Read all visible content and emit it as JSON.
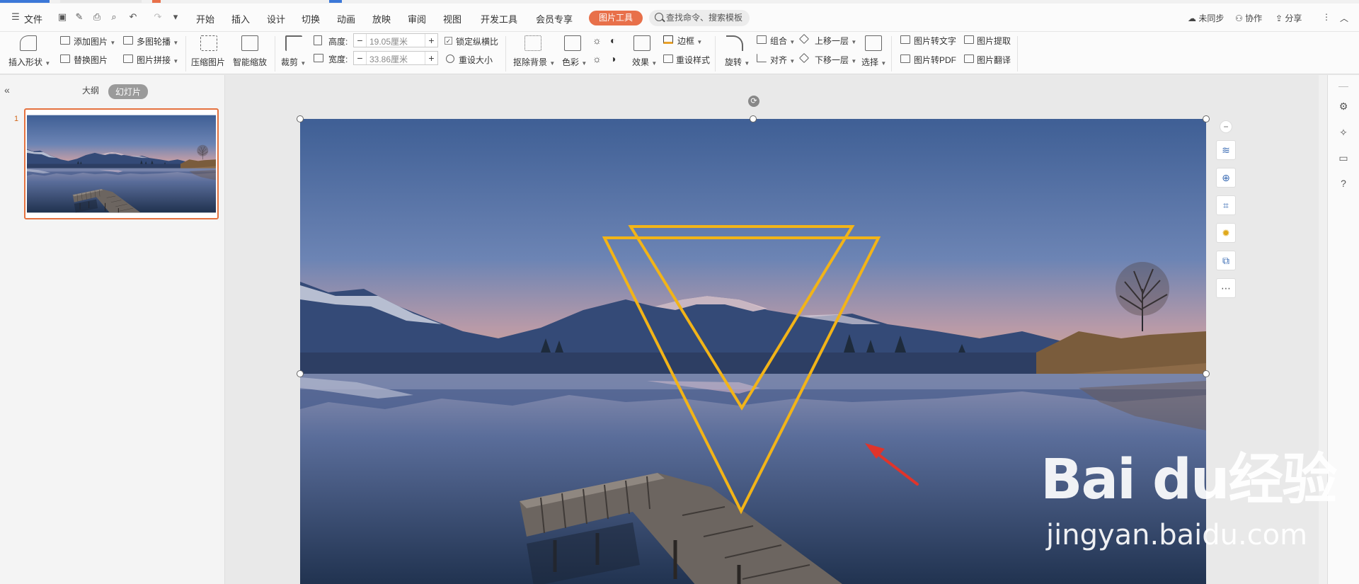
{
  "menu": {
    "file": "文件",
    "tabs": [
      "开始",
      "插入",
      "设计",
      "切换",
      "动画",
      "放映",
      "审阅",
      "视图",
      "开发工具",
      "会员专享"
    ],
    "active_tool": "图片工具",
    "search_placeholder": "查找命令、搜索模板",
    "right": [
      "未同步",
      "协作",
      "分享"
    ]
  },
  "ribbon": {
    "insert_shape": "插入形状",
    "add_picture": "添加图片",
    "replace_picture": "替换图片",
    "multi_carousel": "多图轮播",
    "picture_stitch": "图片拼接",
    "compress": "压缩图片",
    "smart_zoom": "智能缩放",
    "crop": "裁剪",
    "height_label": "高度:",
    "height_value": "19.05厘米",
    "width_label": "宽度:",
    "width_value": "33.86厘米",
    "lock_ratio": "锁定纵横比",
    "reset_size": "重设大小",
    "remove_bg": "抠除背景",
    "color": "色彩",
    "effects": "效果",
    "border": "边框",
    "reset_style": "重设样式",
    "rotate": "旋转",
    "group": "组合",
    "align": "对齐",
    "bring_forward": "上移一层",
    "send_backward": "下移一层",
    "select": "选择",
    "pic_to_text": "图片转文字",
    "pic_to_pdf": "图片转PDF",
    "pic_extract": "图片提取",
    "pic_translate": "图片翻译"
  },
  "panel": {
    "outline": "大纲",
    "slides": "幻灯片",
    "slide_number": "1"
  },
  "watermark": {
    "brand": "Bai du经验",
    "url": "jingyan.baidu.com"
  },
  "colors": {
    "accent": "#e8704a",
    "triangle": "#f2b418",
    "arrow": "#e0342a"
  }
}
